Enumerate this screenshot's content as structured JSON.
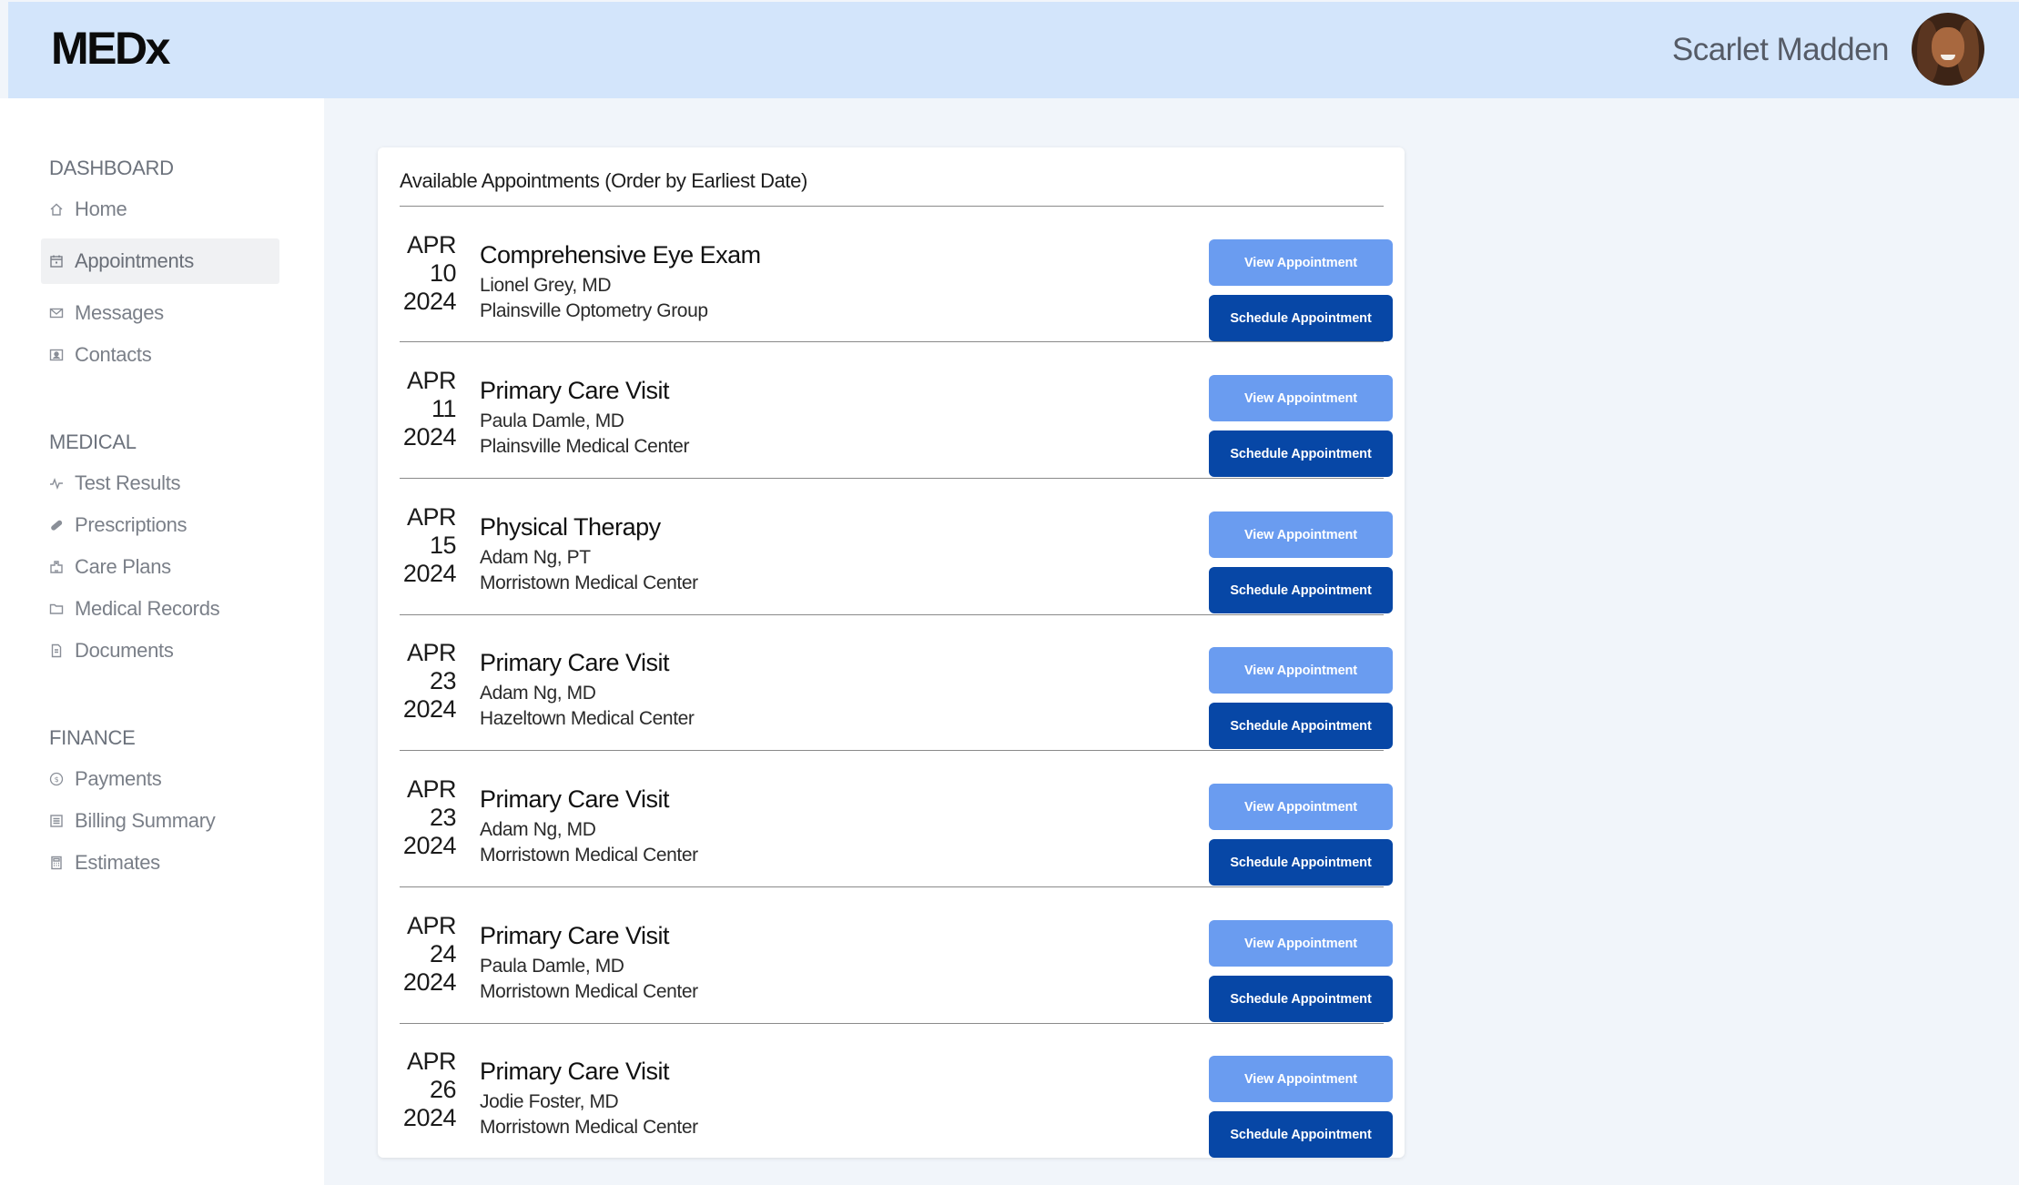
{
  "header": {
    "logo": "MEDx",
    "user_name": "Scarlet Madden"
  },
  "sidebar": {
    "sections": [
      {
        "title": "DASHBOARD",
        "items": [
          {
            "label": "Home",
            "icon": "home-icon"
          },
          {
            "label": "Appointments",
            "icon": "calendar-icon",
            "active": true
          },
          {
            "label": "Messages",
            "icon": "mail-icon"
          },
          {
            "label": "Contacts",
            "icon": "contact-card-icon"
          }
        ]
      },
      {
        "title": "MEDICAL",
        "items": [
          {
            "label": "Test Results",
            "icon": "pulse-icon"
          },
          {
            "label": "Prescriptions",
            "icon": "pill-icon"
          },
          {
            "label": "Care Plans",
            "icon": "hospital-icon"
          },
          {
            "label": "Medical Records",
            "icon": "folder-icon"
          },
          {
            "label": "Documents",
            "icon": "document-icon"
          }
        ]
      },
      {
        "title": "FINANCE",
        "items": [
          {
            "label": "Payments",
            "icon": "dollar-coin-icon"
          },
          {
            "label": "Billing Summary",
            "icon": "receipt-icon"
          },
          {
            "label": "Estimates",
            "icon": "calculator-icon"
          }
        ]
      }
    ]
  },
  "main": {
    "title": "Available Appointments (Order by Earliest Date)",
    "view_label": "View Appointment",
    "schedule_label": "Schedule Appointment",
    "appointments": [
      {
        "month": "APR",
        "day": "10",
        "year": "2024",
        "title": "Comprehensive Eye Exam",
        "provider": "Lionel Grey, MD",
        "location": "Plainsville Optometry Group"
      },
      {
        "month": "APR",
        "day": "11",
        "year": "2024",
        "title": "Primary Care Visit",
        "provider": "Paula Damle, MD",
        "location": "Plainsville Medical Center"
      },
      {
        "month": "APR",
        "day": "15",
        "year": "2024",
        "title": "Physical Therapy",
        "provider": "Adam Ng, PT",
        "location": "Morristown Medical Center"
      },
      {
        "month": "APR",
        "day": "23",
        "year": "2024",
        "title": "Primary Care Visit",
        "provider": "Adam Ng, MD",
        "location": "Hazeltown Medical Center"
      },
      {
        "month": "APR",
        "day": "23",
        "year": "2024",
        "title": "Primary Care Visit",
        "provider": "Adam Ng, MD",
        "location": "Morristown Medical Center"
      },
      {
        "month": "APR",
        "day": "24",
        "year": "2024",
        "title": "Primary Care Visit",
        "provider": "Paula Damle, MD",
        "location": "Morristown Medical Center"
      },
      {
        "month": "APR",
        "day": "26",
        "year": "2024",
        "title": "Primary Care Visit",
        "provider": "Jodie Foster, MD",
        "location": "Morristown Medical Center"
      }
    ]
  },
  "colors": {
    "header_bg": "#d3e5fb",
    "view_button": "#6a9cf0",
    "schedule_button": "#0747a6"
  }
}
